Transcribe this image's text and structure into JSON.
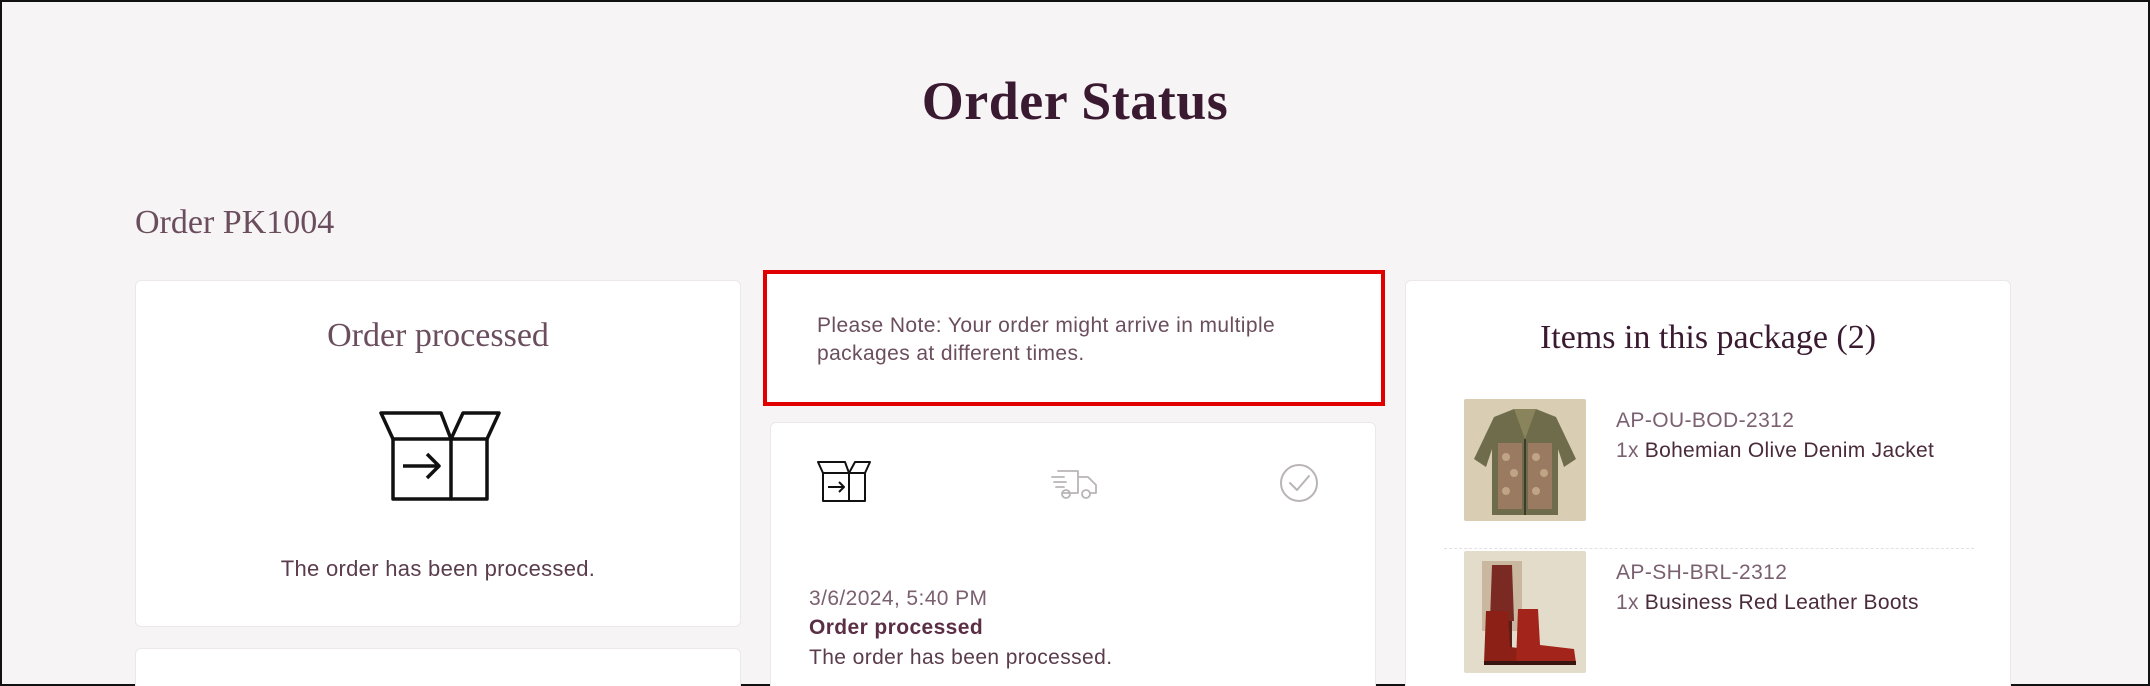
{
  "page": {
    "title": "Order Status",
    "order_label": "Order PK1004"
  },
  "status_card": {
    "heading": "Order processed",
    "icon": "open-box-arrow-icon",
    "description": "The order has been processed."
  },
  "note": {
    "text": "Please Note: Your order might arrive in multiple packages at different times."
  },
  "timeline": {
    "steps": [
      {
        "icon": "box-arrow-icon",
        "state": "active"
      },
      {
        "icon": "delivery-truck-icon",
        "state": "pending"
      },
      {
        "icon": "check-circle-icon",
        "state": "pending"
      }
    ],
    "latest": {
      "date": "3/6/2024, 5:40 PM",
      "status": "Order processed",
      "description": "The order has been processed."
    }
  },
  "package": {
    "heading": "Items in this package (2)",
    "items": [
      {
        "sku": "AP-OU-BOD-2312",
        "qty": "1x",
        "name": "Bohemian Olive Denim Jacket"
      },
      {
        "sku": "AP-SH-BRL-2312",
        "qty": "1x",
        "name": "Business Red Leather Boots"
      }
    ]
  },
  "colors": {
    "accent": "#3a1a30",
    "highlight": "#e10000",
    "text": "#6b4e5e"
  }
}
